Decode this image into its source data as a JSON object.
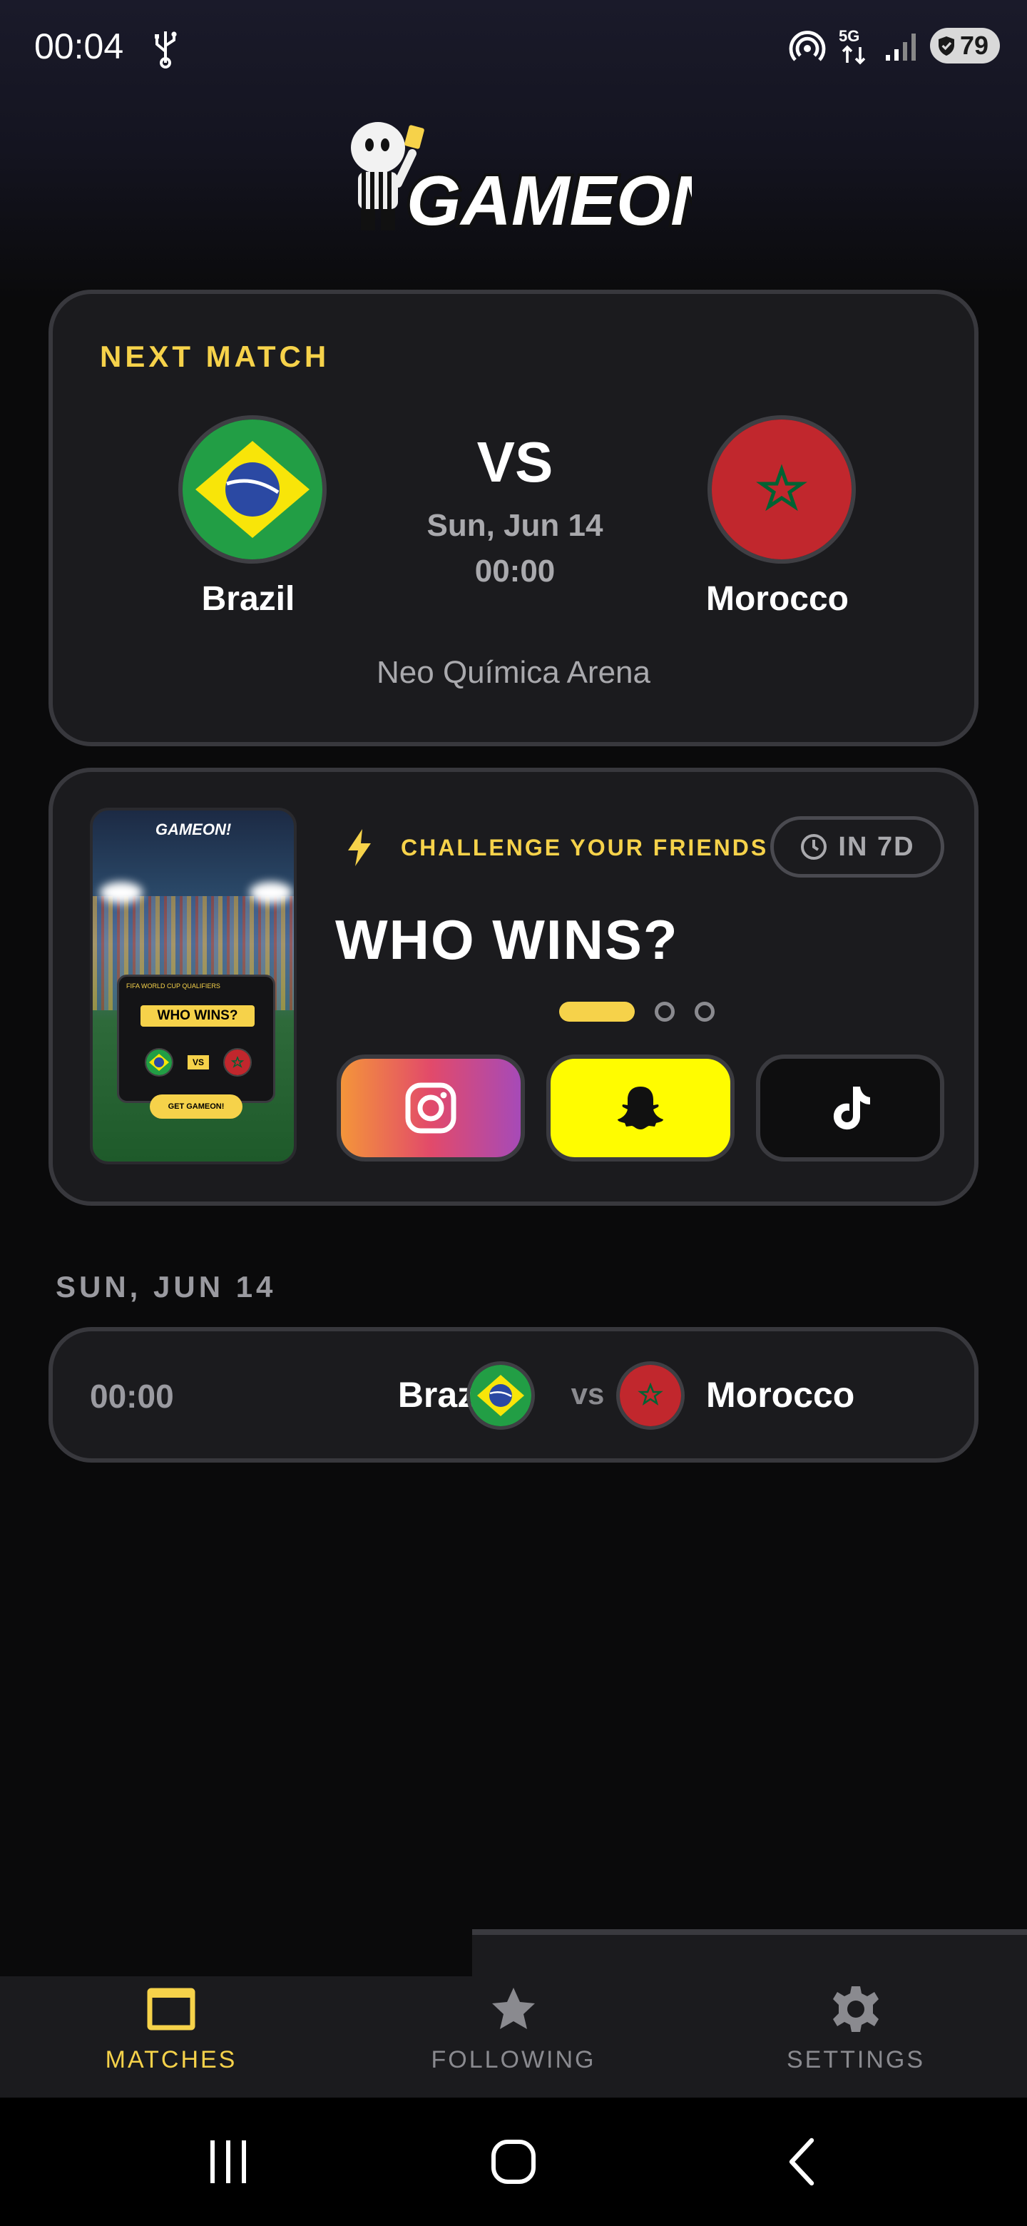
{
  "status_bar": {
    "time": "00:04",
    "battery": "79",
    "icons": [
      "usb-icon",
      "hotspot-icon",
      "5g-icon",
      "signal-icon",
      "battery-icon"
    ]
  },
  "logo": {
    "text": "GAMEON!"
  },
  "next_match": {
    "heading": "NEXT MATCH",
    "home_team": "Brazil",
    "away_team": "Morocco",
    "vs": "VS",
    "date": "Sun, Jun 14",
    "time": "00:00",
    "venue": "Neo Química Arena"
  },
  "challenge": {
    "label": "CHALLENGE YOUR FRIENDS",
    "countdown": "IN 7D",
    "headline": "WHO WINS?",
    "preview": {
      "logo": "GAMEON!",
      "subtitle": "FIFA WORLD CUP QUALIFIERS",
      "headline": "WHO WINS?",
      "vs": "VS",
      "cta": "GET GAMEON!"
    },
    "share_buttons": [
      "instagram",
      "snapchat",
      "tiktok"
    ],
    "pager": {
      "total": 3,
      "active": 1
    }
  },
  "schedule": {
    "day_header": "SUN, JUN 14",
    "matches": [
      {
        "time": "00:00",
        "home": "Brazil",
        "vs": "vs",
        "away": "Morocco"
      }
    ]
  },
  "bottom_nav": {
    "items": [
      {
        "label": "MATCHES",
        "icon": "matches-icon",
        "active": true
      },
      {
        "label": "FOLLOWING",
        "icon": "star-icon",
        "active": false
      },
      {
        "label": "SETTINGS",
        "icon": "gear-icon",
        "active": false
      }
    ]
  },
  "colors": {
    "accent": "#f6d24a",
    "background": "#0a0a0b",
    "card": "#1b1b1e",
    "border": "#38383d",
    "muted": "#a9a9ad"
  }
}
